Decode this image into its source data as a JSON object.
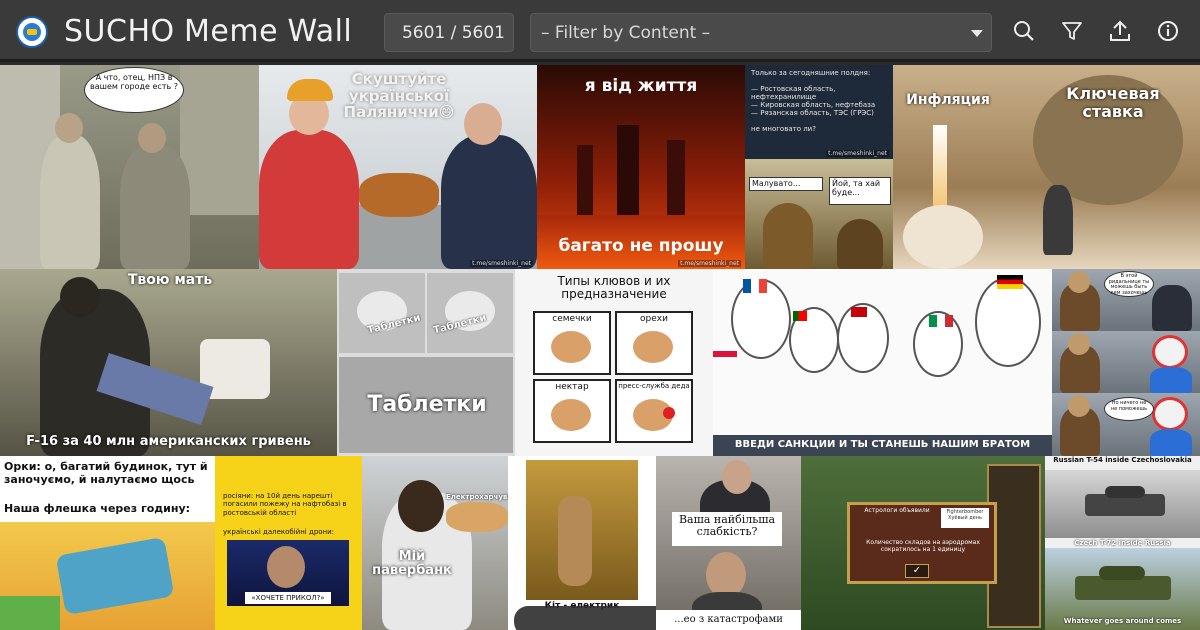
{
  "header": {
    "title_parts": [
      "SUCHO",
      "Meme",
      "Wall"
    ],
    "counter": "5601 / 5601",
    "filter_placeholder": "– Filter by Content –",
    "icons": [
      "search-icon",
      "filter-icon",
      "upload-icon",
      "info-icon"
    ]
  },
  "memes": {
    "m1": {
      "bubble": "А что, отец, НПЗ в вашем городе есть ?"
    },
    "m2": {
      "caption": "Скуштуйте української Паляниччи😅",
      "wm": "t.me/smeshinki_net"
    },
    "m3": {
      "top": "я від життя",
      "bottom": "багато не прошу",
      "wm": "t.me/smeshinki_net"
    },
    "m4": {
      "text": "Только за сегодняшние полдня:\n\n— Ростовская область, нефтехранилище\n— Кировская область, нефтебаза\n— Рязанская область, ТЭС (ГРЭС)\n\nне многовато ли?",
      "wm": "t.me/smeshinki_net",
      "left": "Малувато...",
      "right": "Йой, та хай буде..."
    },
    "m5": {
      "left": "Инфляция",
      "right": "Ключевая ставка"
    },
    "m6": {
      "top": "Твою мать",
      "bottom": "F-16 за 40 млн американских гривень"
    },
    "m7": {
      "label_small_a": "Таблетки",
      "label_small_b": "Таблетки",
      "label_big": "Таблетки"
    },
    "m8": {
      "title": "Типы клювов и их предназначение",
      "cells": [
        "семечки",
        "орехи",
        "нектар",
        "пресс-служба деда"
      ]
    },
    "m9": {
      "caption": "ВВЕДИ САНКЦИИ И ТЫ СТАНЕШЬ НАШИМ БРАТОМ"
    },
    "m10": {
      "b1": "В этой ридальнице ты можешь быть кем захочешь",
      "b2": "",
      "b3": "Но ничего не не поможешь"
    },
    "m11": {
      "top": "Орки: о, багатий будинок, тут й заночуємо, й налутаємо щось",
      "bottom": "Наша флешка через годину:"
    },
    "m12": {
      "text": "росіяни: на 10й день нарешті погасили пожежу на нафтобазі в ростовській області",
      "text2": "українські далекобійні дрони:",
      "tag": "«ХОЧЕТЕ ПРИКОЛ?»"
    },
    "m13": {
      "label1": "Електрохарчування",
      "label2": "Мій павербанк"
    },
    "m14": {
      "caption": "Кіт - електрик"
    },
    "m15": {
      "top": "Ваша найбільша слабкість?",
      "bottom": "...ео з катастрофами"
    },
    "m16": {
      "banner": "Астрологи объявили",
      "badge": "Fighterbomber Хуёвый день",
      "body": "Количество складов на аэродромах сократилось на 1 единицу"
    },
    "m17": {
      "top": "Russian T-54 inside Czechoslovakia",
      "middle": "Czech T-72 inside Russia",
      "bottom": "Whatever goes around comes"
    }
  }
}
